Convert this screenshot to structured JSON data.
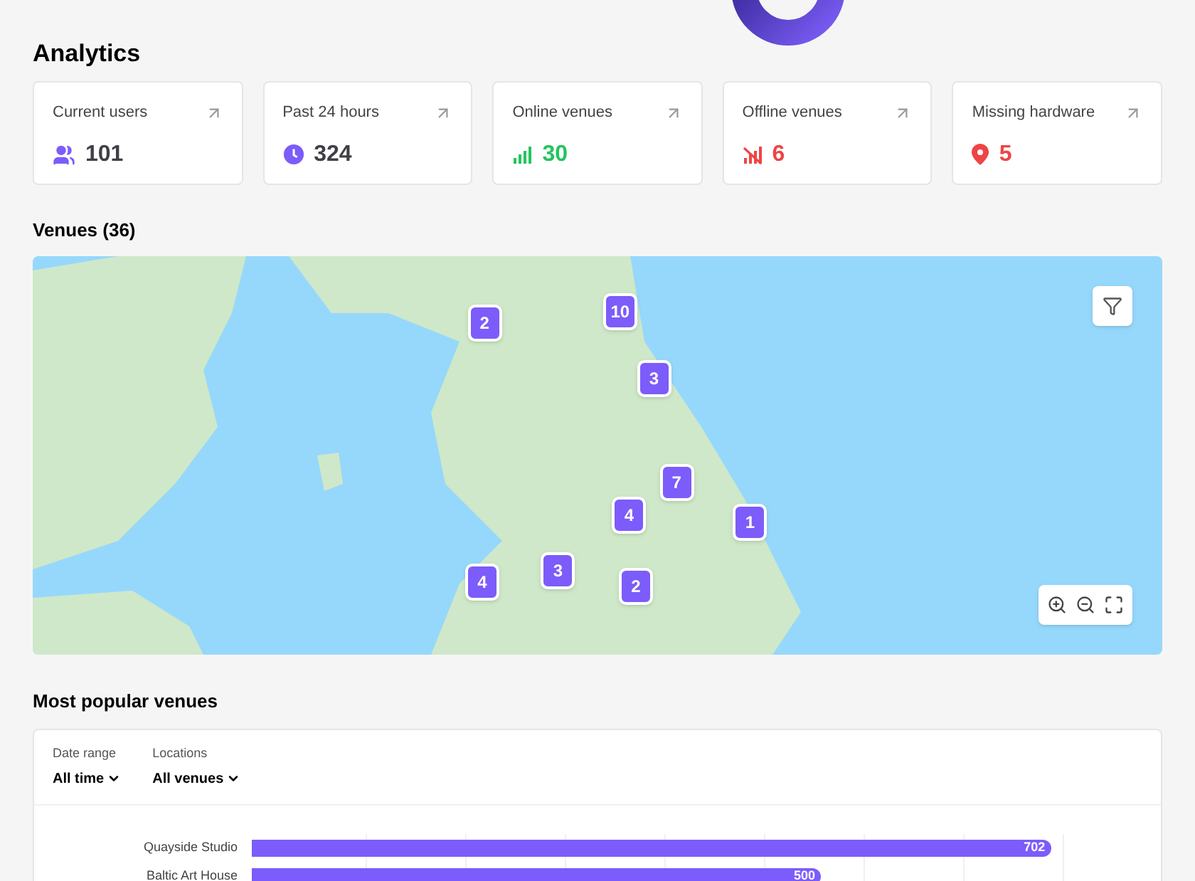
{
  "analytics": {
    "title": "Analytics",
    "cards": [
      {
        "label": "Current users",
        "value": "101",
        "kind": "users",
        "color": "#3f3f46"
      },
      {
        "label": "Past 24 hours",
        "value": "324",
        "kind": "clock",
        "color": "#3f3f46"
      },
      {
        "label": "Online venues",
        "value": "30",
        "kind": "signal",
        "color": "#22c55e"
      },
      {
        "label": "Offline venues",
        "value": "6",
        "kind": "no-signal",
        "color": "#ef4444"
      },
      {
        "label": "Missing hardware",
        "value": "5",
        "kind": "pin",
        "color": "#ef4444"
      }
    ]
  },
  "venues": {
    "title": "Venues (36)",
    "markers": [
      {
        "count": "2"
      },
      {
        "count": "10"
      },
      {
        "count": "3"
      },
      {
        "count": "7"
      },
      {
        "count": "4"
      },
      {
        "count": "1"
      },
      {
        "count": "4"
      },
      {
        "count": "3"
      },
      {
        "count": "2"
      }
    ]
  },
  "popular": {
    "title": "Most popular venues",
    "filters": [
      {
        "label": "Date range",
        "value": "All time"
      },
      {
        "label": "Locations",
        "value": "All venues"
      }
    ],
    "chart_data": {
      "type": "bar",
      "orientation": "horizontal",
      "categories": [
        "Quayside Studio",
        "Baltic Art House"
      ],
      "values": [
        702,
        500
      ],
      "data_labels": true
    }
  }
}
